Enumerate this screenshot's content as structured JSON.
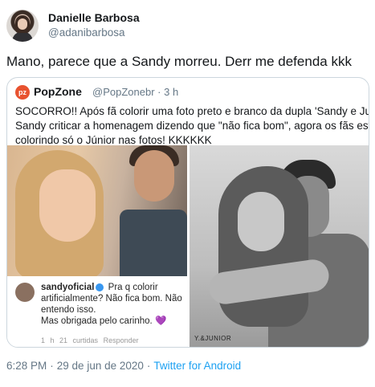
{
  "author": {
    "display_name": "Danielle Barbosa",
    "handle": "@adanibarbosa"
  },
  "tweet": {
    "text": "Mano, parece que a Sandy morreu. Derr me defenda kkk"
  },
  "quoted_tweet": {
    "logo_text": "pz",
    "name": "PopZone",
    "handle": "@PopZonebr",
    "separator": "·",
    "time": "3 h",
    "text_lines": [
      "SOCORRO!! Após fã colorir uma foto preto e branco da dupla 'Sandy e Junior' e",
      "Sandy criticar a homenagem dizendo que \"não fica bom\", agora os fãs estão",
      "colorindo só o Júnior nas fotos! KKKKKK"
    ],
    "comment": {
      "username": "sandyoficial",
      "line1": "Pra q colorir",
      "line2": "artificialmente? Não fica bom. Não",
      "line3": "entendo isso.",
      "line4": "Mas obrigada pelo carinho.",
      "heart": "💜",
      "meta_time": "1 h",
      "meta_likes": "21 curtidas",
      "meta_reply": "Responder"
    },
    "watermark": "Y.&JUNIOR"
  },
  "footer": {
    "time": "6:28 PM",
    "date": "29 de jun de 2020",
    "separator": "·",
    "source": "Twitter for Android"
  }
}
